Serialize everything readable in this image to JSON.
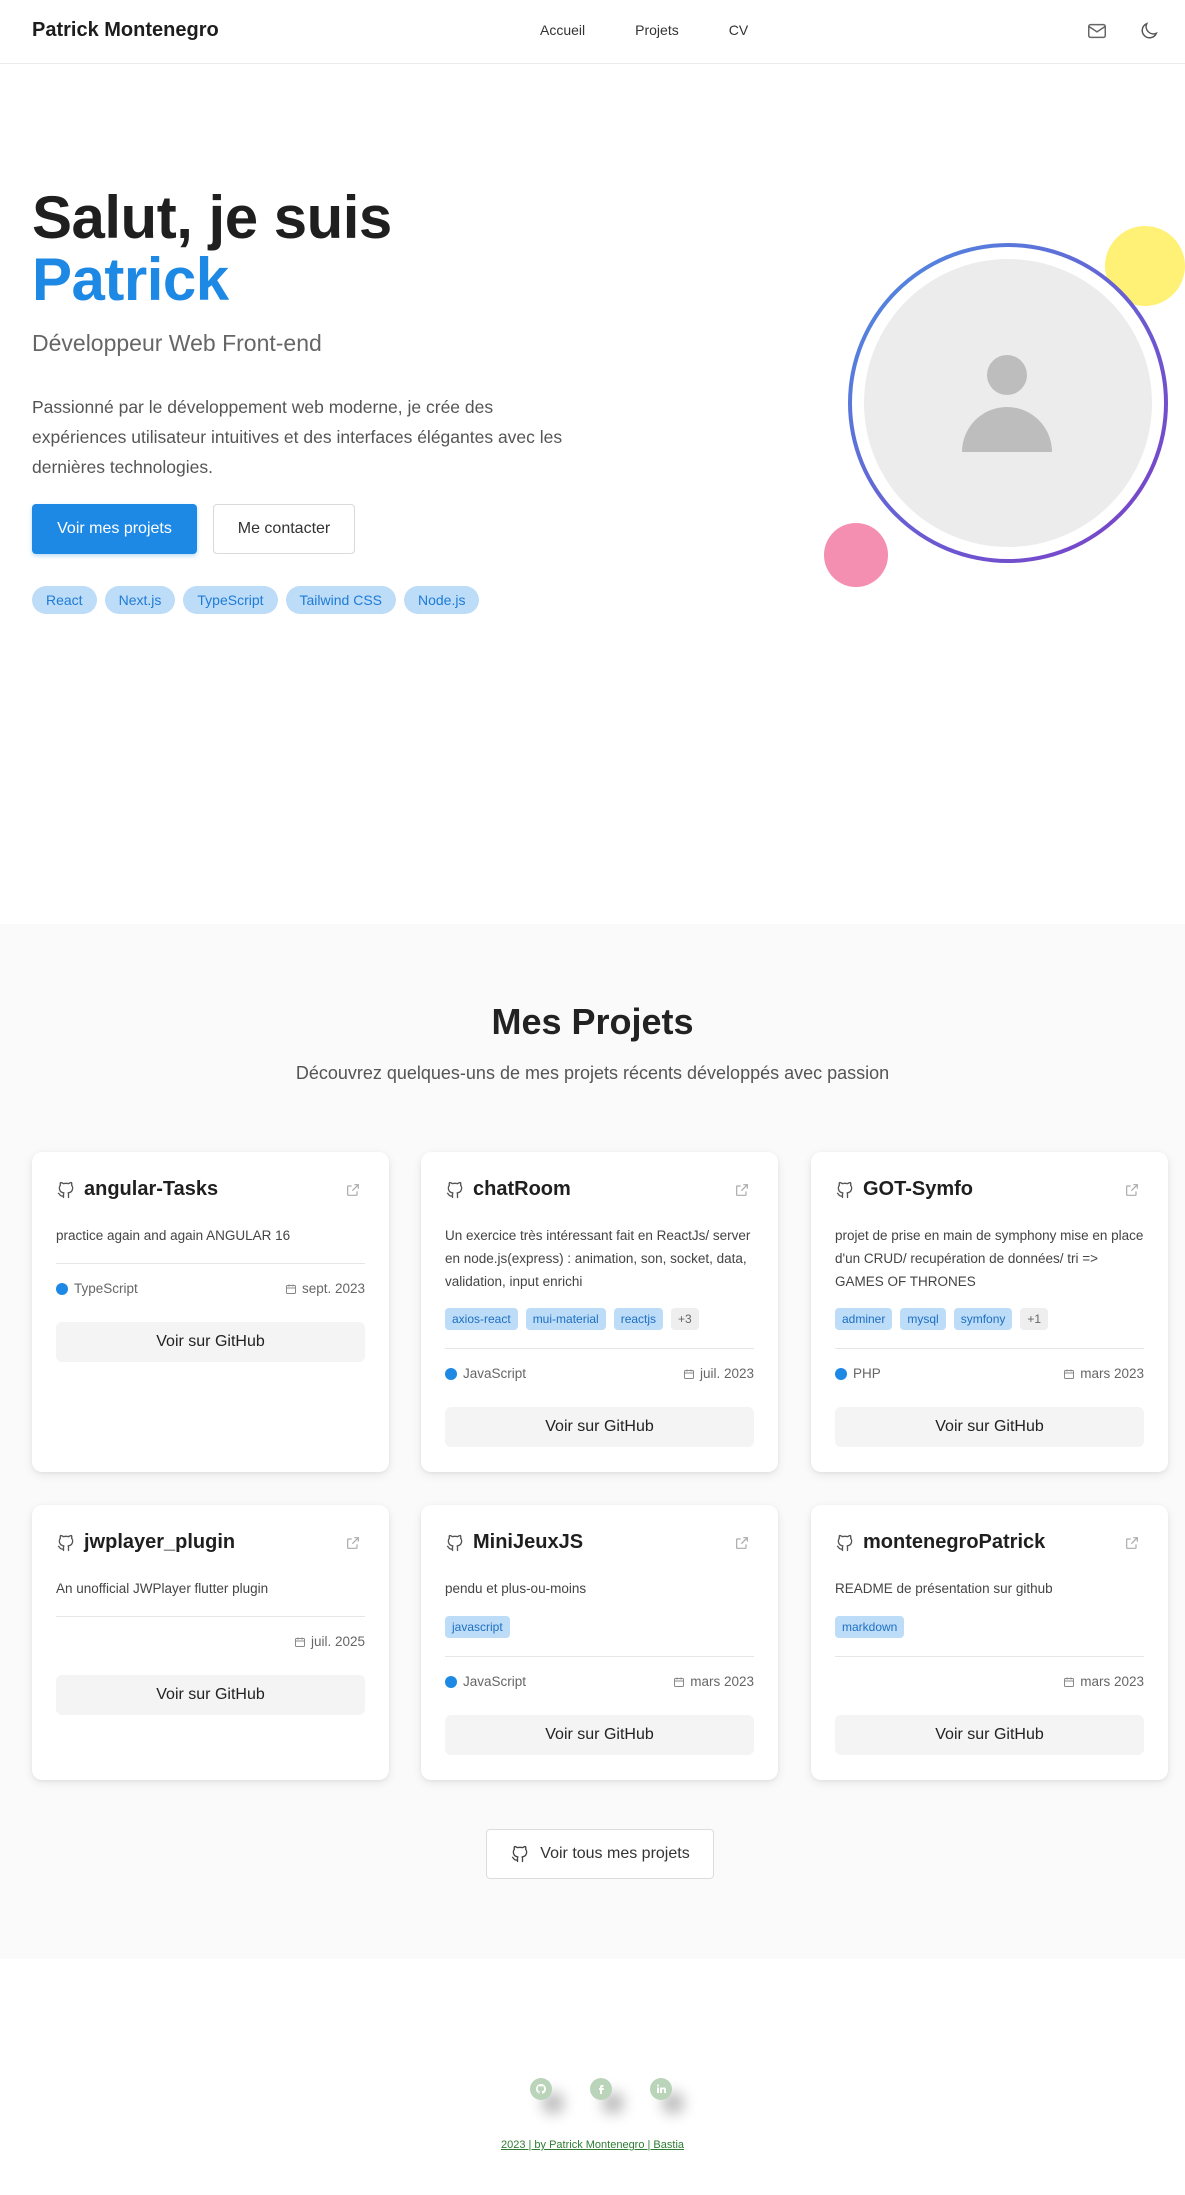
{
  "header": {
    "brand": "Patrick Montenegro",
    "nav": [
      "Accueil",
      "Projets",
      "CV"
    ],
    "icons": [
      "mail-icon",
      "moon-icon"
    ]
  },
  "hero": {
    "title_line1": "Salut, je suis",
    "title_name": "Patrick",
    "subtitle": "Développeur Web Front-end",
    "description": "Passionné par le développement web moderne, je crée des expériences utilisateur intuitives et des interfaces élégantes avec les dernières technologies.",
    "primary_button": "Voir mes projets",
    "secondary_button": "Me contacter",
    "skills": [
      "React",
      "Next.js",
      "TypeScript",
      "Tailwind CSS",
      "Node.js"
    ],
    "accent_color": "#1e88e5"
  },
  "projects": {
    "title": "Mes Projets",
    "subtitle": "Découvrez quelques-uns de mes projets récents développés avec passion",
    "github_label": "Voir sur GitHub",
    "all_button": "Voir tous mes projets",
    "items": [
      {
        "name": "angular-Tasks",
        "description": "practice again and again ANGULAR 16",
        "tags": [],
        "language": "TypeScript",
        "date": "sept. 2023"
      },
      {
        "name": "chatRoom",
        "description": "Un exercice très intéressant fait en ReactJs/ server en node.js(express) : animation, son, socket, data, validation, input enrichi",
        "tags": [
          "axios-react",
          "mui-material",
          "reactjs",
          "+3"
        ],
        "language": "JavaScript",
        "date": "juil. 2023"
      },
      {
        "name": "GOT-Symfo",
        "description": "projet de prise en main de symphony mise en place d'un CRUD/ recupération de données/ tri => GAMES OF THRONES",
        "tags": [
          "adminer",
          "mysql",
          "symfony",
          "+1"
        ],
        "language": "PHP",
        "date": "mars 2023"
      },
      {
        "name": "jwplayer_plugin",
        "description": "An unofficial JWPlayer flutter plugin",
        "tags": [],
        "language": "",
        "date": "juil. 2025"
      },
      {
        "name": "MiniJeuxJS",
        "description": "pendu et plus-ou-moins",
        "tags": [
          "javascript"
        ],
        "language": "JavaScript",
        "date": "mars 2023"
      },
      {
        "name": "montenegroPatrick",
        "description": "README de présentation sur github",
        "tags": [
          "markdown"
        ],
        "language": "",
        "date": "mars 2023"
      }
    ]
  },
  "footer": {
    "socials": [
      "github-icon",
      "facebook-icon",
      "linkedin-icon"
    ],
    "text": "2023 | by Patrick Montenegro | Bastia"
  }
}
